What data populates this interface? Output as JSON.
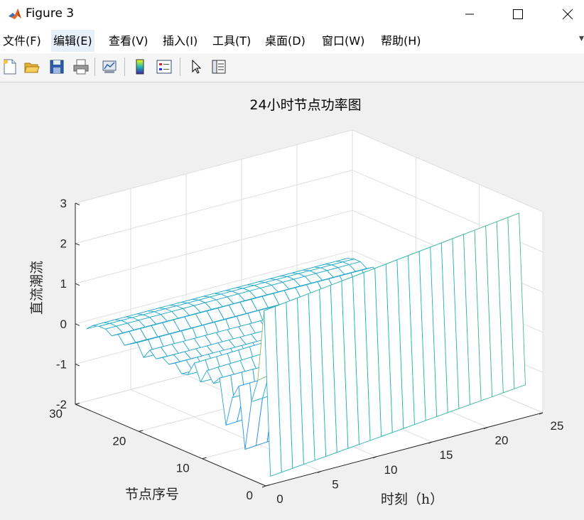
{
  "window": {
    "title": "Figure 3"
  },
  "menu": [
    "文件(F)",
    "编辑(E)",
    "查看(V)",
    "插入(I)",
    "工具(T)",
    "桌面(D)",
    "窗口(W)",
    "帮助(H)"
  ],
  "menu_active_index": 1,
  "menu_overflow": "▾",
  "toolbar": [
    {
      "name": "new-figure-icon"
    },
    {
      "name": "open-file-icon"
    },
    {
      "name": "save-icon"
    },
    {
      "name": "print-icon"
    },
    {
      "name": "link-plot-icon"
    },
    {
      "name": "colorbar-icon"
    },
    {
      "name": "legend-icon"
    },
    {
      "name": "pointer-icon"
    },
    {
      "name": "property-inspector-icon"
    }
  ],
  "chart_data": {
    "type": "surface-mesh",
    "title": "24小时节点功率图",
    "xlabel": "时刻（h）",
    "ylabel": "节点序号",
    "zlabel": "直流潮流",
    "xlim": [
      0,
      25
    ],
    "ylim": [
      0,
      30
    ],
    "zlim": [
      -2,
      3
    ],
    "xticks": [
      "0",
      "5",
      "10",
      "15",
      "20",
      "25"
    ],
    "yticks": [
      "0",
      "10",
      "20",
      "30"
    ],
    "zticks": [
      "-2",
      "-1",
      "0",
      "1",
      "2",
      "3"
    ],
    "grid": true,
    "colormap": "parula",
    "x_hours": [
      1,
      24
    ],
    "nodes": [
      1,
      30
    ],
    "node_profiles": [
      {
        "node": 1,
        "value_hour1": -1.9,
        "value_hour24": -1.3
      },
      {
        "node": 2,
        "value_hour1": 2.15,
        "value_hour24": 2.9
      },
      {
        "node": 3,
        "value_hour1": 0.35,
        "value_hour24": 1.5
      },
      {
        "node": 4,
        "value_hour1": -0.25,
        "value_hour24": 0.15
      },
      {
        "node": 5,
        "value_hour1": -1.5,
        "value_hour24": -1.05
      },
      {
        "node": 6,
        "value_hour1": 0.0,
        "value_hour24": 0.2
      },
      {
        "node": 7,
        "value_hour1": -0.35,
        "value_hour24": -0.2
      },
      {
        "node": 8,
        "value_hour1": -1.1,
        "value_hour24": -0.8
      },
      {
        "node": 9,
        "value_hour1": 0.0,
        "value_hour24": 0.0
      },
      {
        "node": 10,
        "value_hour1": -0.2,
        "value_hour24": -0.3
      },
      {
        "node": 11,
        "value_hour1": 0.05,
        "value_hour24": 0.3
      },
      {
        "node": 12,
        "value_hour1": -0.3,
        "value_hour24": -0.4
      },
      {
        "node": 13,
        "value_hour1": 0.1,
        "value_hour24": 0.3
      },
      {
        "node": 14,
        "value_hour1": -0.25,
        "value_hour24": -0.3
      },
      {
        "node": 15,
        "value_hour1": -0.3,
        "value_hour24": -0.4
      },
      {
        "node": 16,
        "value_hour1": -0.1,
        "value_hour24": -0.1
      },
      {
        "node": 17,
        "value_hour1": -0.2,
        "value_hour24": -0.3
      },
      {
        "node": 18,
        "value_hour1": -0.1,
        "value_hour24": -0.1
      },
      {
        "node": 19,
        "value_hour1": -0.2,
        "value_hour24": -0.3
      },
      {
        "node": 20,
        "value_hour1": -0.05,
        "value_hour24": -0.05
      },
      {
        "node": 21,
        "value_hour1": -0.3,
        "value_hour24": -0.45
      },
      {
        "node": 22,
        "value_hour1": 0.0,
        "value_hour24": 0.0
      },
      {
        "node": 23,
        "value_hour1": -0.1,
        "value_hour24": -0.1
      },
      {
        "node": 24,
        "value_hour1": -0.2,
        "value_hour24": -0.25
      },
      {
        "node": 25,
        "value_hour1": 0.0,
        "value_hour24": 0.0
      },
      {
        "node": 26,
        "value_hour1": -0.1,
        "value_hour24": -0.1
      },
      {
        "node": 27,
        "value_hour1": 0.0,
        "value_hour24": 0.0
      },
      {
        "node": 28,
        "value_hour1": 0.0,
        "value_hour24": 0.0
      },
      {
        "node": 29,
        "value_hour1": -0.05,
        "value_hour24": -0.05
      },
      {
        "node": 30,
        "value_hour1": -0.2,
        "value_hour24": -0.2
      }
    ]
  }
}
